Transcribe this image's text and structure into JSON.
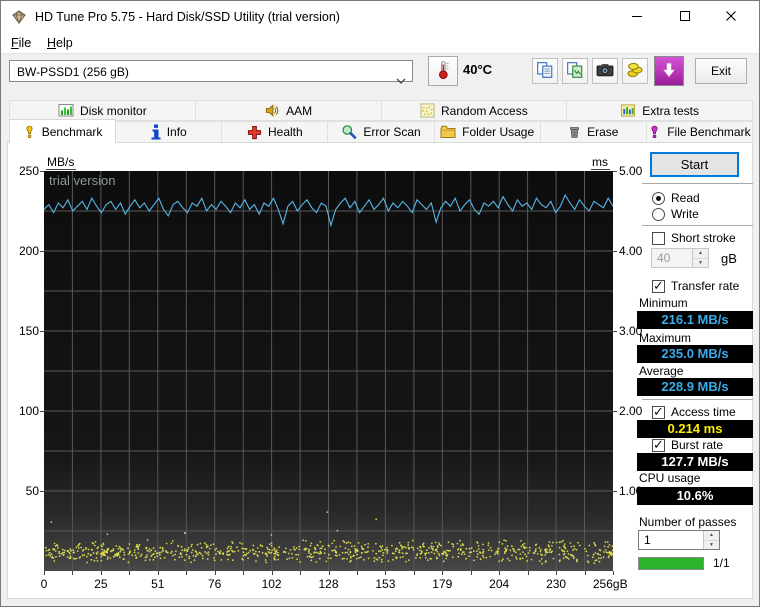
{
  "window": {
    "title": "HD Tune Pro 5.75 - Hard Disk/SSD Utility (trial version)",
    "controls": [
      {
        "name": "minimize-button",
        "icon": "minimize-icon"
      },
      {
        "name": "maximize-button",
        "icon": "maximize-icon"
      },
      {
        "name": "close-button",
        "icon": "close-icon"
      }
    ]
  },
  "menu": {
    "items": [
      "File",
      "Help"
    ]
  },
  "toolbar": {
    "device_select": "BW-PSSD1 (256 gB)",
    "temperature": "40°C",
    "exit_label": "Exit",
    "buttons": [
      {
        "name": "copy-text-button",
        "icon": "copy-pages-icon"
      },
      {
        "name": "copy-image-button",
        "icon": "copy-image-icon"
      },
      {
        "name": "screenshot-button",
        "icon": "camera-icon"
      },
      {
        "name": "purchase-button",
        "icon": "coins-icon"
      }
    ]
  },
  "tabs_row1": [
    {
      "label": "Disk monitor",
      "icon": "disk-monitor-icon"
    },
    {
      "label": "AAM",
      "icon": "speaker-icon"
    },
    {
      "label": "Random Access",
      "icon": "random-access-icon"
    },
    {
      "label": "Extra tests",
      "icon": "extra-tests-icon"
    }
  ],
  "tabs_row2": [
    {
      "label": "Benchmark",
      "icon": "benchmark-icon",
      "active": true
    },
    {
      "label": "Info",
      "icon": "info-icon"
    },
    {
      "label": "Health",
      "icon": "health-icon"
    },
    {
      "label": "Error Scan",
      "icon": "error-scan-icon"
    },
    {
      "label": "Folder Usage",
      "icon": "folder-icon"
    },
    {
      "label": "Erase",
      "icon": "erase-icon"
    },
    {
      "label": "File Benchmark",
      "icon": "file-benchmark-icon"
    }
  ],
  "panel": {
    "start_label": "Start",
    "read_label": "Read",
    "read_selected": true,
    "write_label": "Write",
    "write_selected": false,
    "short_stroke_label": "Short stroke",
    "short_stroke_checked": false,
    "short_stroke_value": "40",
    "short_stroke_unit": "gB",
    "transfer_rate_label": "Transfer rate",
    "transfer_rate_checked": true,
    "minimum_label": "Minimum",
    "minimum_value": "216.1 MB/s",
    "maximum_label": "Maximum",
    "maximum_value": "235.0 MB/s",
    "average_label": "Average",
    "average_value": "228.9 MB/s",
    "access_time_label": "Access time",
    "access_time_checked": true,
    "access_time_value": "0.214 ms",
    "burst_rate_label": "Burst rate",
    "burst_rate_checked": true,
    "burst_rate_value": "127.7 MB/s",
    "cpu_usage_label": "CPU usage",
    "cpu_usage_value": "10.6%",
    "passes_label": "Number of passes",
    "passes_value": "1",
    "progress_text": "1/1",
    "progress_fraction": 1
  },
  "chart_data": {
    "type": "line",
    "watermark": "trial version",
    "x_axis": {
      "range_gb": [
        0,
        256
      ],
      "ticks": [
        "0",
        "25",
        "51",
        "76",
        "102",
        "128",
        "153",
        "179",
        "204",
        "230",
        "256gB"
      ]
    },
    "y_left": {
      "label": "MB/s",
      "range": [
        0,
        250
      ],
      "ticks": [
        250,
        200,
        150,
        100,
        50
      ]
    },
    "y_right": {
      "label": "ms",
      "range": [
        0,
        5
      ],
      "ticks": [
        "5.00",
        "4.00",
        "3.00",
        "2.00",
        "1.00"
      ]
    },
    "grid": {
      "v_divisions": 20,
      "h_divisions": 10,
      "color": "#585858"
    },
    "series": [
      {
        "name": "transfer-rate",
        "unit": "MB/s",
        "color": "#58b6e8",
        "values": [
          226,
          229,
          224,
          230,
          227,
          232,
          225,
          228,
          231,
          226,
          233,
          228,
          224,
          229,
          231,
          226,
          230,
          223,
          228,
          232,
          227,
          230,
          225,
          229,
          233,
          226,
          222,
          229,
          231,
          227,
          224,
          230,
          228,
          233,
          225,
          229,
          226,
          231,
          228,
          224,
          230,
          227,
          232,
          226,
          229,
          223,
          230,
          228,
          233,
          226,
          217,
          228,
          231,
          225,
          229,
          232,
          227,
          224,
          230,
          228,
          216,
          226,
          230,
          233,
          227,
          231,
          224,
          228,
          232,
          226,
          229,
          233,
          225,
          230,
          227,
          231,
          228,
          224,
          232,
          229,
          226,
          230,
          218,
          227,
          231,
          228,
          233,
          225,
          229,
          232,
          226,
          223,
          230,
          228,
          231,
          227,
          234,
          229,
          225,
          232,
          228,
          230,
          226,
          233,
          229,
          227,
          231,
          224,
          228,
          235,
          230,
          226,
          232,
          228,
          225,
          231,
          229,
          227,
          233,
          228
        ]
      },
      {
        "name": "access-time",
        "unit": "ms",
        "color": "#e8e64e",
        "style": "scatter",
        "count": 850,
        "ms_range": [
          0.08,
          0.4
        ],
        "outliers": 6,
        "outlier_ms_range": [
          0.45,
          0.75
        ]
      }
    ],
    "stats": {
      "min_mbs": 216.1,
      "max_mbs": 235.0,
      "avg_mbs": 228.9,
      "access_time_ms": 0.214,
      "burst_rate_mbs": 127.7,
      "cpu_pct": 10.6
    }
  }
}
